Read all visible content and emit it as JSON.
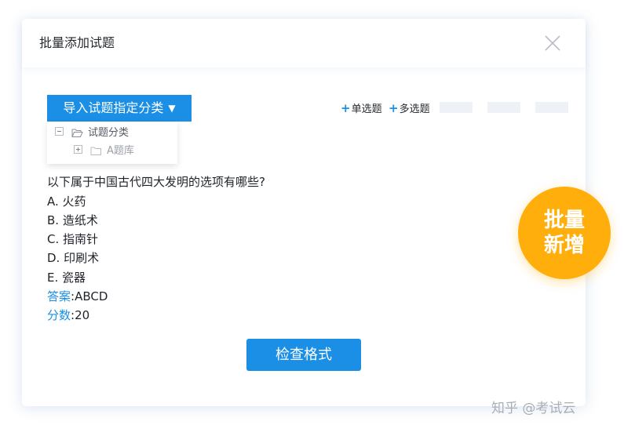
{
  "dialog": {
    "title": "批量添加试题",
    "close_icon": "close-icon"
  },
  "toolbar": {
    "import_label": "导入试题指定分类",
    "import_caret": "▼",
    "single_choice_plus": "+",
    "single_choice_label": "单选题",
    "multi_choice_plus": "+",
    "multi_choice_label": "多选题"
  },
  "category_tree": {
    "items": [
      {
        "label": "试题分类",
        "icon": "folder-open-icon",
        "expander": "collapse-icon"
      },
      {
        "label": "A题库",
        "icon": "folder-icon",
        "expander": "expand-icon"
      }
    ]
  },
  "question": {
    "stem": "以下属于中国古代四大发明的选项有哪些?",
    "options": [
      "A. 火药",
      "B. 造纸术",
      "C. 指南针",
      "D. 印刷术",
      "E. 瓷器"
    ],
    "answer_key": "答案",
    "answer_value": ":ABCD",
    "score_key": "分数",
    "score_value": ":20"
  },
  "check_format_label": "检查格式",
  "badge": {
    "line1": "批量",
    "line2": "新增"
  },
  "watermark": "知乎 @考试云",
  "colors": {
    "accent": "#1a8fe5",
    "badge": "#ffae0c",
    "placeholder": "#eef1f5"
  }
}
